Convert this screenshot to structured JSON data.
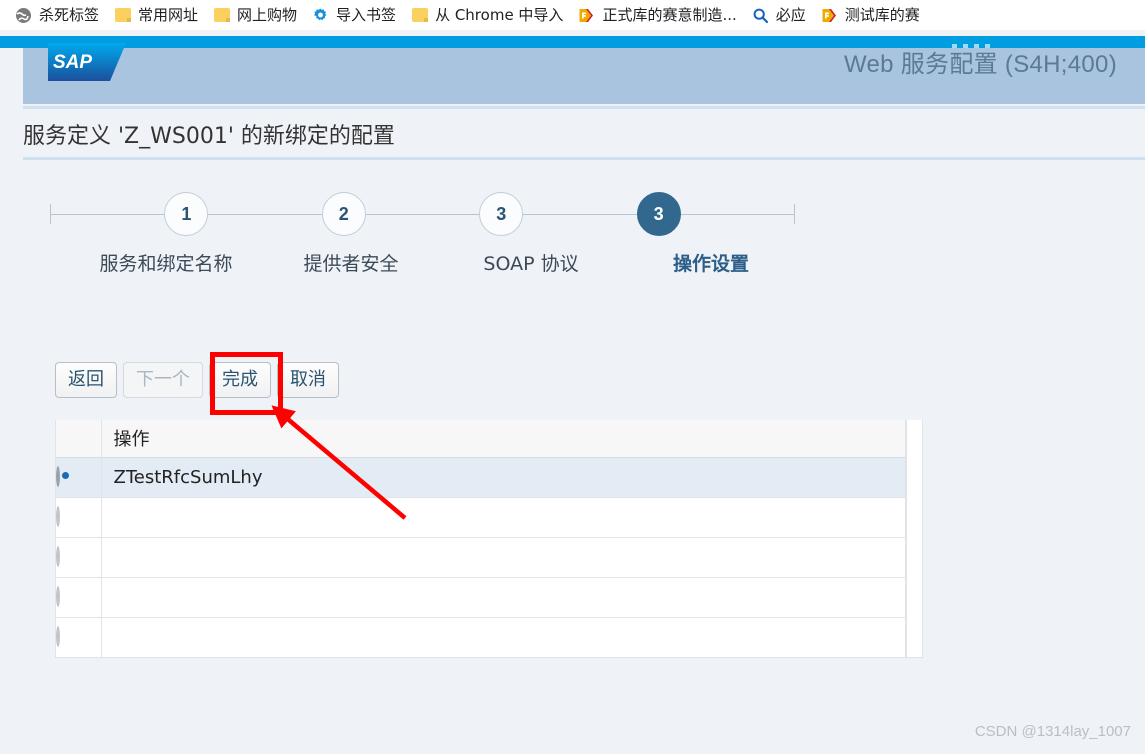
{
  "browser": {
    "bookmarks": [
      {
        "label": "杀死标签",
        "icon": "globe-icon"
      },
      {
        "label": "常用网址",
        "icon": "folder-icon"
      },
      {
        "label": "网上购物",
        "icon": "folder-icon"
      },
      {
        "label": "导入书签",
        "icon": "gear-icon"
      },
      {
        "label": "从 Chrome 中导入",
        "icon": "folder-icon"
      },
      {
        "label": "正式库的赛意制造...",
        "icon": "sap-b1-icon"
      },
      {
        "label": "必应",
        "icon": "search-icon"
      },
      {
        "label": "测试库的赛",
        "icon": "sap-b1-icon"
      }
    ]
  },
  "app": {
    "logo_text": "SAP",
    "header_title": "Web 服务配置 (S4H;400)",
    "page_title": "服务定义 'Z_WS001' 的新绑定的配置"
  },
  "roadmap": {
    "steps": [
      {
        "number": "1",
        "label": "服务和绑定名称",
        "active": false
      },
      {
        "number": "2",
        "label": "提供者安全",
        "active": false
      },
      {
        "number": "3",
        "label": "SOAP 协议",
        "active": false
      },
      {
        "number": "3",
        "label": "操作设置",
        "active": true
      }
    ]
  },
  "toolbar": {
    "back_label": "返回",
    "next_label": "下一个",
    "finish_label": "完成",
    "cancel_label": "取消"
  },
  "table": {
    "columns": [
      "",
      "操作"
    ],
    "rows": [
      {
        "operation": "ZTestRfcSumLhy",
        "selected": true
      },
      {
        "operation": "",
        "selected": false
      },
      {
        "operation": "",
        "selected": false
      },
      {
        "operation": "",
        "selected": false
      },
      {
        "operation": "",
        "selected": false
      }
    ]
  },
  "watermark": "CSDN @1314lay_1007",
  "colors": {
    "top_bar_blue": "#009de0",
    "header_band": "#a8c4de",
    "page_bg": "#eff3f7",
    "active_step": "#33688e",
    "annotation_red": "#ff0000",
    "selected_row": "#e3ebf5"
  }
}
